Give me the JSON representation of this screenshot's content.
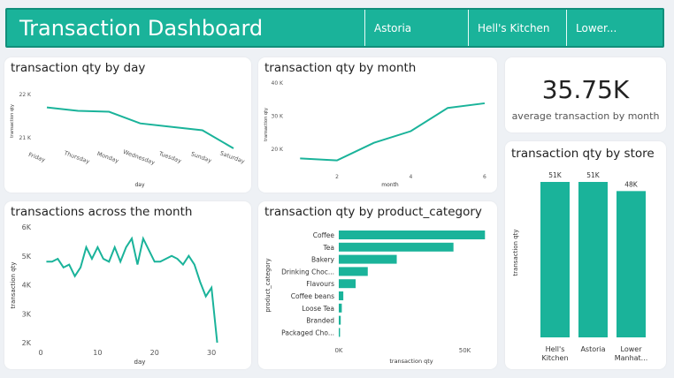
{
  "header": {
    "title": "Transaction Dashboard",
    "slicers": [
      "Astoria",
      "Hell's Kitchen",
      "Lower..."
    ]
  },
  "colors": {
    "accent": "#1ab39a",
    "accent_dark": "#118f7b"
  },
  "kpi": {
    "value": "35.75K",
    "label": "average transaction by month"
  },
  "chart_data": [
    {
      "id": "by_day",
      "type": "line",
      "title": "transaction qty by day",
      "xlabel": "day",
      "ylabel": "transaction qty",
      "categories": [
        "Friday",
        "Thursday",
        "Monday",
        "Wednesday",
        "Tuesday",
        "Sunday",
        "Saturday"
      ],
      "values": [
        21700,
        21620,
        21600,
        21330,
        21250,
        21170,
        20750
      ],
      "ylim": [
        20750,
        22000
      ],
      "yticks": [
        {
          "v": 21000,
          "label": "21 K"
        },
        {
          "v": 22000,
          "label": "22 K"
        }
      ]
    },
    {
      "id": "by_month",
      "type": "line",
      "title": "transaction qty by month",
      "xlabel": "month",
      "ylabel": "transaction qty",
      "x": [
        1,
        2,
        3,
        4,
        5,
        6
      ],
      "values": [
        17300,
        16700,
        22000,
        25500,
        32500,
        33900
      ],
      "ylim": [
        15000,
        40000
      ],
      "xlim": [
        0.85,
        6.05
      ],
      "yticks": [
        {
          "v": 20000,
          "label": "20 K"
        },
        {
          "v": 30000,
          "label": "30 K"
        },
        {
          "v": 40000,
          "label": "40 K"
        }
      ],
      "xticks": [
        2,
        4,
        6
      ]
    },
    {
      "id": "by_store",
      "type": "bar",
      "title": "transaction qty by store",
      "ylabel": "transaction qty",
      "categories": [
        "Hell's Kitchen",
        "Astoria",
        "Lower Manhat..."
      ],
      "values": [
        51000,
        51000,
        48000
      ],
      "value_labels": [
        "51K",
        "51K",
        "48K"
      ],
      "ylim": [
        0,
        51000
      ]
    },
    {
      "id": "across_month",
      "type": "line",
      "title": "transactions across the month",
      "xlabel": "day",
      "ylabel": "transaction qty",
      "x": [
        1,
        2,
        3,
        4,
        5,
        6,
        7,
        8,
        9,
        10,
        11,
        12,
        13,
        14,
        15,
        16,
        17,
        18,
        19,
        20,
        21,
        22,
        23,
        24,
        25,
        26,
        27,
        28,
        29,
        30,
        31
      ],
      "values": [
        4800,
        4800,
        4900,
        4600,
        4700,
        4300,
        4600,
        5300,
        4900,
        5300,
        4900,
        4800,
        5300,
        4800,
        5300,
        5600,
        4700,
        5600,
        5200,
        4800,
        4800,
        4900,
        5000,
        4900,
        4700,
        5000,
        4700,
        4100,
        3600,
        3900,
        2000
      ],
      "xlim": [
        0,
        32
      ],
      "ylim": [
        2000,
        6000
      ],
      "yticks": [
        {
          "v": 2000,
          "label": "2K"
        },
        {
          "v": 3000,
          "label": "3K"
        },
        {
          "v": 4000,
          "label": "4K"
        },
        {
          "v": 5000,
          "label": "5K"
        },
        {
          "v": 6000,
          "label": "6K"
        }
      ],
      "xticks": [
        0,
        10,
        20,
        30
      ]
    },
    {
      "id": "by_category",
      "type": "bar",
      "orientation": "horizontal",
      "title": "transaction qty by product_category",
      "xlabel": "transaction qty",
      "ylabel": "product_category",
      "categories": [
        "Coffee",
        "Tea",
        "Bakery",
        "Drinking Choc...",
        "Flavours",
        "Coffee beans",
        "Loose Tea",
        "Branded",
        "Packaged Cho..."
      ],
      "values": [
        58000,
        45500,
        23000,
        11500,
        6700,
        1800,
        1200,
        780,
        500
      ],
      "xlim": [
        0,
        60000
      ],
      "xticks": [
        {
          "v": 0,
          "label": "0K"
        },
        {
          "v": 50000,
          "label": "50K"
        }
      ]
    }
  ]
}
